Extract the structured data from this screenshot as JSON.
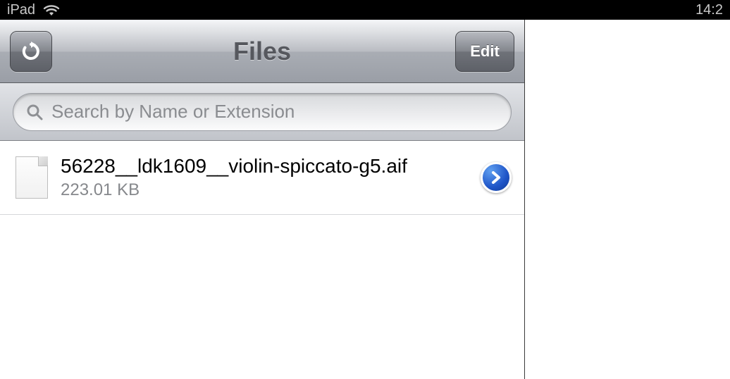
{
  "status": {
    "device": "iPad",
    "time": "14:2"
  },
  "nav": {
    "title": "Files",
    "edit_label": "Edit"
  },
  "search": {
    "placeholder": "Search by Name or Extension",
    "value": ""
  },
  "files": [
    {
      "name": "56228__ldk1609__violin-spiccato-g5.aif",
      "size": "223.01 KB"
    }
  ]
}
